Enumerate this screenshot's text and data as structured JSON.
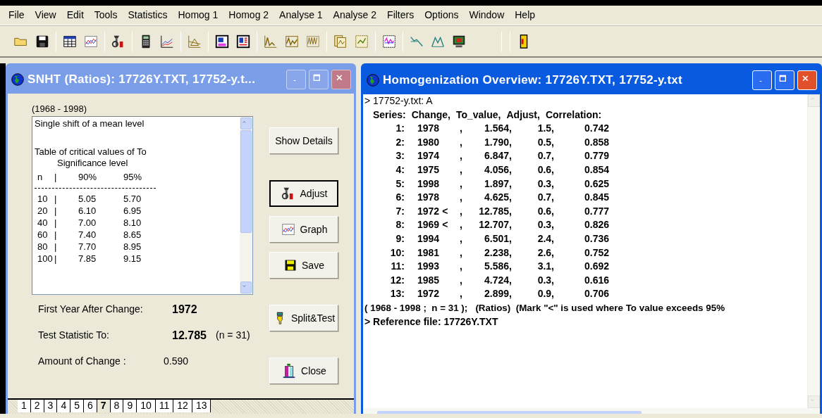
{
  "menu": [
    "File",
    "View",
    "Edit",
    "Tools",
    "Statistics",
    "Homog 1",
    "Homog 2",
    "Analyse 1",
    "Analyse 2",
    "Filters",
    "Options",
    "Window",
    "Help"
  ],
  "snht_window": {
    "title": "SNHT (Ratios):   17726Y.TXT, 17752-y.t...",
    "active": false,
    "period": "(1968 - 1998)",
    "listbox": {
      "lines": [
        "Single shift of a mean level",
        "Table of critical values of To",
        "Significance level"
      ],
      "header": {
        "n": "n",
        "bar": "|",
        "p90": "90%",
        "p95": "95%"
      },
      "rows": [
        {
          "n": "10",
          "bar": "|",
          "p90": "5.05",
          "p95": "5.70"
        },
        {
          "n": "20",
          "bar": "|",
          "p90": "6.10",
          "p95": "6.95"
        },
        {
          "n": "40",
          "bar": "|",
          "p90": "7.00",
          "p95": "8.10"
        },
        {
          "n": "60",
          "bar": "|",
          "p90": "7.40",
          "p95": "8.65"
        },
        {
          "n": "80",
          "bar": "|",
          "p90": "7.70",
          "p95": "8.95"
        },
        {
          "n": "100",
          "bar": "|",
          "p90": "7.85",
          "p95": "9.15"
        }
      ]
    },
    "buttons": [
      {
        "kind": "text",
        "label": "Show Details",
        "default": false
      },
      {
        "kind": "adjust",
        "label": "Adjust",
        "default": true
      },
      {
        "kind": "graph",
        "label": "Graph",
        "default": false
      },
      {
        "kind": "save",
        "label": "Save",
        "default": false
      },
      {
        "kind": "split",
        "label": "Split&Test",
        "default": false
      },
      {
        "kind": "close",
        "label": "Close",
        "default": false
      }
    ],
    "results": [
      {
        "label": "First Year After Change:",
        "value": "1972",
        "bold": true
      },
      {
        "label": "Test Statistic To:",
        "value": "12.785",
        "bold": true,
        "note": "(n = 31)"
      },
      {
        "label": "Amount of Change :",
        "value": "0.590",
        "bold": false
      }
    ],
    "tabs": [
      {
        "label": "1",
        "selected": false
      },
      {
        "label": "2",
        "selected": false
      },
      {
        "label": "3",
        "selected": false
      },
      {
        "label": "4",
        "selected": false
      },
      {
        "label": "5",
        "selected": false
      },
      {
        "label": "6",
        "selected": false
      },
      {
        "label": "7",
        "selected": true
      },
      {
        "label": "8",
        "selected": false
      },
      {
        "label": "9",
        "selected": false
      },
      {
        "label": "10",
        "selected": false
      },
      {
        "label": "11",
        "selected": false
      },
      {
        "label": "12",
        "selected": false
      },
      {
        "label": "13",
        "selected": false
      }
    ]
  },
  "overview_window": {
    "title": "Homogenization Overview:  17726Y.TXT, 17752-y.txt",
    "active": true,
    "file_line": "> 17752-y.txt:  A",
    "columns": [
      "Series:",
      "Change,",
      "To_value,",
      "Adjust,",
      "Correlation:"
    ],
    "rows": [
      {
        "series": "1:",
        "change": "1978",
        "mark": "",
        "sep": ",",
        "to_value": "1.564,",
        "adjust": "1.5,",
        "correlation": "0.742"
      },
      {
        "series": "2:",
        "change": "1980",
        "mark": "",
        "sep": ",",
        "to_value": "1.790,",
        "adjust": "0.5,",
        "correlation": "0.858"
      },
      {
        "series": "3:",
        "change": "1974",
        "mark": "",
        "sep": ",",
        "to_value": "6.847,",
        "adjust": "0.7,",
        "correlation": "0.779"
      },
      {
        "series": "4:",
        "change": "1975",
        "mark": "",
        "sep": ",",
        "to_value": "4.056,",
        "adjust": "0.6,",
        "correlation": "0.854"
      },
      {
        "series": "5:",
        "change": "1998",
        "mark": "",
        "sep": ",",
        "to_value": "1.897,",
        "adjust": "0.3,",
        "correlation": "0.625"
      },
      {
        "series": "6:",
        "change": "1978",
        "mark": "",
        "sep": ",",
        "to_value": "4.625,",
        "adjust": "0.7,",
        "correlation": "0.845"
      },
      {
        "series": "7:",
        "change": "1972",
        "mark": "<",
        "sep": ",",
        "to_value": "12.785,",
        "adjust": "0.6,",
        "correlation": "0.777"
      },
      {
        "series": "8:",
        "change": "1969",
        "mark": "<",
        "sep": ",",
        "to_value": "12.707,",
        "adjust": "0.3,",
        "correlation": "0.826"
      },
      {
        "series": "9:",
        "change": "1994",
        "mark": "",
        "sep": ",",
        "to_value": "6.501,",
        "adjust": "2.4,",
        "correlation": "0.736"
      },
      {
        "series": "10:",
        "change": "1981",
        "mark": "",
        "sep": ",",
        "to_value": "2.238,",
        "adjust": "2.6,",
        "correlation": "0.752"
      },
      {
        "series": "11:",
        "change": "1993",
        "mark": "",
        "sep": ",",
        "to_value": "5.586,",
        "adjust": "3.1,",
        "correlation": "0.692"
      },
      {
        "series": "12:",
        "change": "1985",
        "mark": "",
        "sep": ",",
        "to_value": "4.724,",
        "adjust": "0.3,",
        "correlation": "0.616"
      },
      {
        "series": "13:",
        "change": "1972",
        "mark": "",
        "sep": ",",
        "to_value": "2.899,",
        "adjust": "0.9,",
        "correlation": "0.706"
      }
    ],
    "summary": "( 1968 - 1998 ;  n = 31 );   (Ratios)  (Mark \"<\" is used where To value exceeds 95%",
    "reference_line": "> Reference file: 17726Y.TXT"
  }
}
